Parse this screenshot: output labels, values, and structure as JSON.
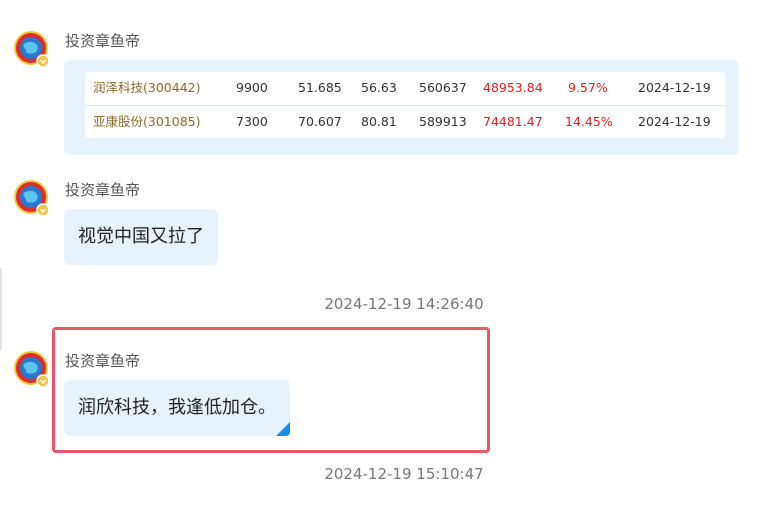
{
  "messages": [
    {
      "user": "投资章鱼帝",
      "type": "table",
      "rows": [
        {
          "name": "润泽科技(300442)",
          "qty": "9900",
          "cost": "51.685",
          "price": "56.63",
          "value": "560637",
          "profit": "48953.84",
          "pct": "9.57%",
          "date": "2024-12-19"
        },
        {
          "name": "亚康股份(301085)",
          "qty": "7300",
          "cost": "70.607",
          "price": "80.81",
          "value": "589913",
          "profit": "74481.47",
          "pct": "14.45%",
          "date": "2024-12-19"
        }
      ]
    },
    {
      "user": "投资章鱼帝",
      "type": "text",
      "text": "视觉中国又拉了"
    },
    {
      "timestamp": "2024-12-19 14:26:40"
    },
    {
      "user": "投资章鱼帝",
      "type": "text",
      "text": "润欣科技，我逢低加仓。"
    },
    {
      "timestamp": "2024-12-19 15:10:47"
    }
  ],
  "colors": {
    "bubble": "#e7f3fc",
    "highlight": "#e85a63",
    "loss_gain_red": "#e02020",
    "stock_name": "#8a6a2a"
  },
  "icons": {
    "avatar": "globe-avatar-icon"
  }
}
